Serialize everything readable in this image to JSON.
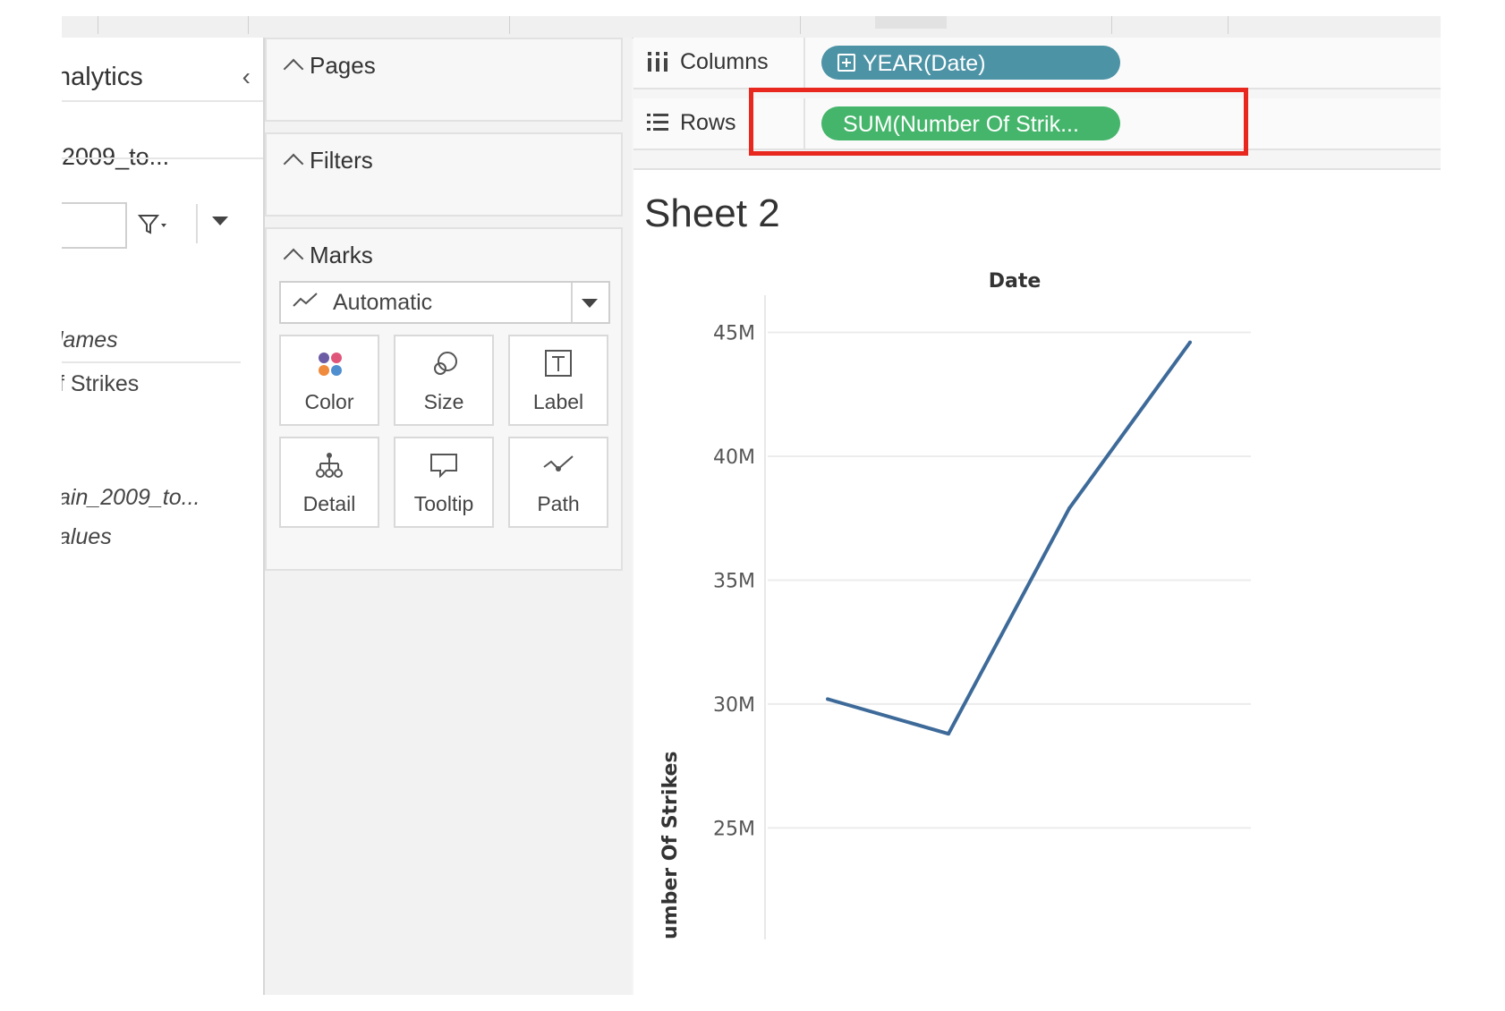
{
  "data_pane": {
    "header": "nalytics",
    "collapse_icon": "chevron-left-icon",
    "source": "2009_to...",
    "filter_icon": "funnel-icon",
    "fields": [
      {
        "label": "lames",
        "italic": true
      },
      {
        "label": "f Strikes",
        "italic": false
      },
      {
        "label": "ain_2009_to...",
        "italic": true
      },
      {
        "label": "alues",
        "italic": true
      }
    ]
  },
  "cards": {
    "pages": "Pages",
    "filters": "Filters",
    "marks": "Marks",
    "mark_type": "Automatic",
    "mark_type_icon": "line-mark-icon",
    "buttons": [
      "Color",
      "Size",
      "Label",
      "Detail",
      "Tooltip",
      "Path"
    ]
  },
  "shelves": {
    "columns_label": "Columns",
    "columns_pill": "YEAR(Date)",
    "rows_label": "Rows",
    "rows_pill": "SUM(Number Of Strik...",
    "colors": {
      "columns_pill": "#4d93a6",
      "rows_pill": "#45b56b",
      "highlight": "#e8271f"
    }
  },
  "sheet": {
    "title": "Sheet 2"
  },
  "chart_data": {
    "type": "line",
    "title": "",
    "header": "Date",
    "ylabel": "Number Of Strikes",
    "ylabel_visible": "umber Of Strikes",
    "y_ticks": [
      "45M",
      "40M",
      "35M",
      "30M",
      "25M"
    ],
    "y_tick_values": [
      45000000,
      40000000,
      35000000,
      30000000,
      25000000
    ],
    "ylim": [
      20500000,
      46500000
    ],
    "grid": true,
    "series": [
      {
        "values": [
          30200000,
          28800000,
          37900000,
          44600000
        ],
        "color": "#3d6a99"
      }
    ]
  }
}
